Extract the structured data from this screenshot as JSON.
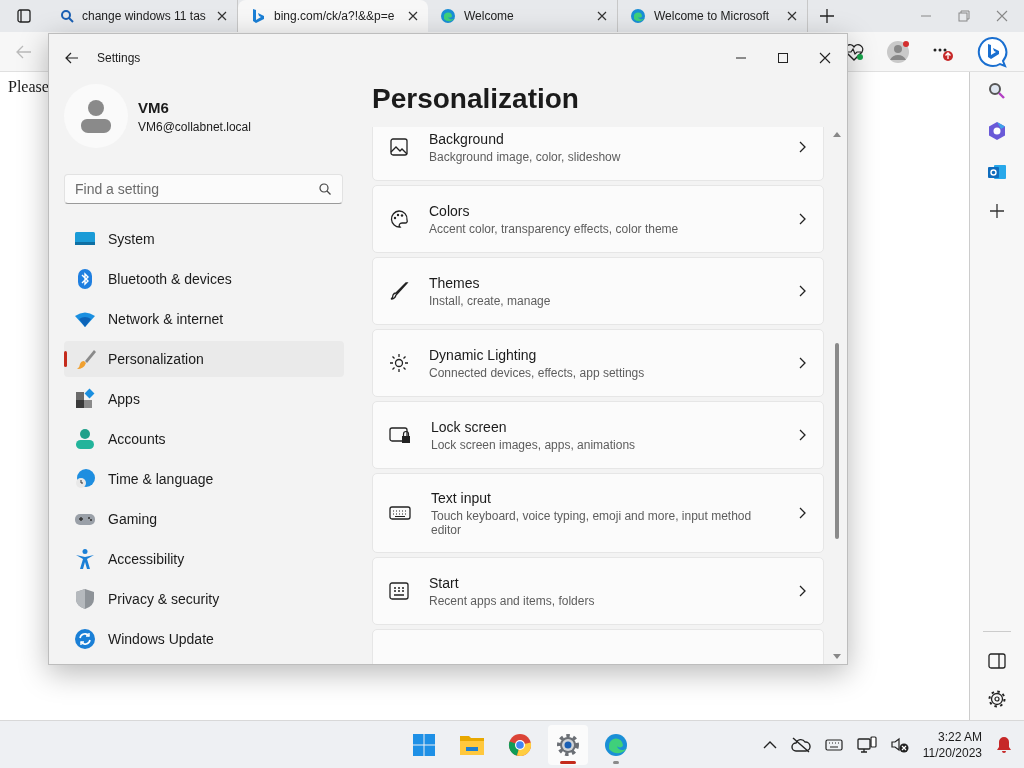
{
  "browser": {
    "tabs": [
      {
        "title": "change windows 11 tas",
        "selected": false
      },
      {
        "title": "bing.com/ck/a?!&&p=e",
        "selected": true
      },
      {
        "title": "Welcome",
        "selected": false
      },
      {
        "title": "Welcome to Microsoft",
        "selected": false
      }
    ],
    "page_text": "Please"
  },
  "settings": {
    "title": "Settings",
    "user": {
      "name": "VM6",
      "email": "VM6@collabnet.local"
    },
    "search": {
      "placeholder": "Find a setting"
    },
    "nav": [
      {
        "label": "System",
        "selected": false
      },
      {
        "label": "Bluetooth & devices",
        "selected": false
      },
      {
        "label": "Network & internet",
        "selected": false
      },
      {
        "label": "Personalization",
        "selected": true
      },
      {
        "label": "Apps",
        "selected": false
      },
      {
        "label": "Accounts",
        "selected": false
      },
      {
        "label": "Time & language",
        "selected": false
      },
      {
        "label": "Gaming",
        "selected": false
      },
      {
        "label": "Accessibility",
        "selected": false
      },
      {
        "label": "Privacy & security",
        "selected": false
      },
      {
        "label": "Windows Update",
        "selected": false
      }
    ],
    "heading": "Personalization",
    "cards": [
      {
        "title": "Background",
        "subtitle": "Background image, color, slideshow"
      },
      {
        "title": "Colors",
        "subtitle": "Accent color, transparency effects, color theme"
      },
      {
        "title": "Themes",
        "subtitle": "Install, create, manage"
      },
      {
        "title": "Dynamic Lighting",
        "subtitle": "Connected devices, effects, app settings"
      },
      {
        "title": "Lock screen",
        "subtitle": "Lock screen images, apps, animations"
      },
      {
        "title": "Text input",
        "subtitle": "Touch keyboard, voice typing, emoji and more, input method editor"
      },
      {
        "title": "Start",
        "subtitle": "Recent apps and items, folders"
      }
    ]
  },
  "taskbar": {
    "apps": [
      {
        "selected": false
      },
      {
        "selected": false
      },
      {
        "selected": false
      },
      {
        "selected": true
      },
      {
        "selected": false
      }
    ],
    "time": "3:22 AM",
    "date": "11/20/2023"
  }
}
